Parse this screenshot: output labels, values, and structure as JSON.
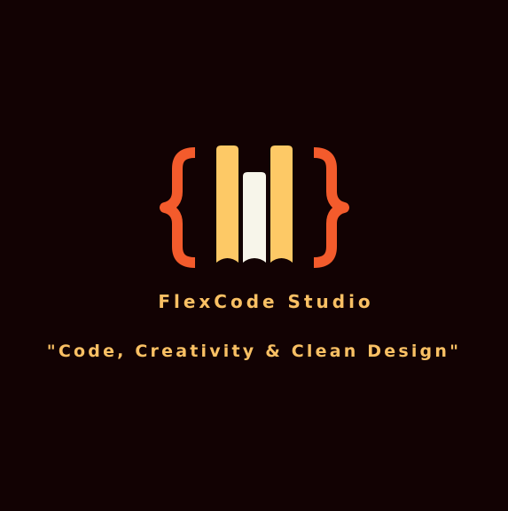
{
  "brand": {
    "name": "FlexCode Studio",
    "tagline": "\"Code, Creativity & Clean Design\""
  },
  "logo": {
    "icon": "code-bookshelf-icon",
    "colors": {
      "braces": "#f35b2c",
      "outer_bars": "#fdc966",
      "center_bar": "#f7f5ea",
      "background": "#120203",
      "text": "#f9c064"
    }
  }
}
